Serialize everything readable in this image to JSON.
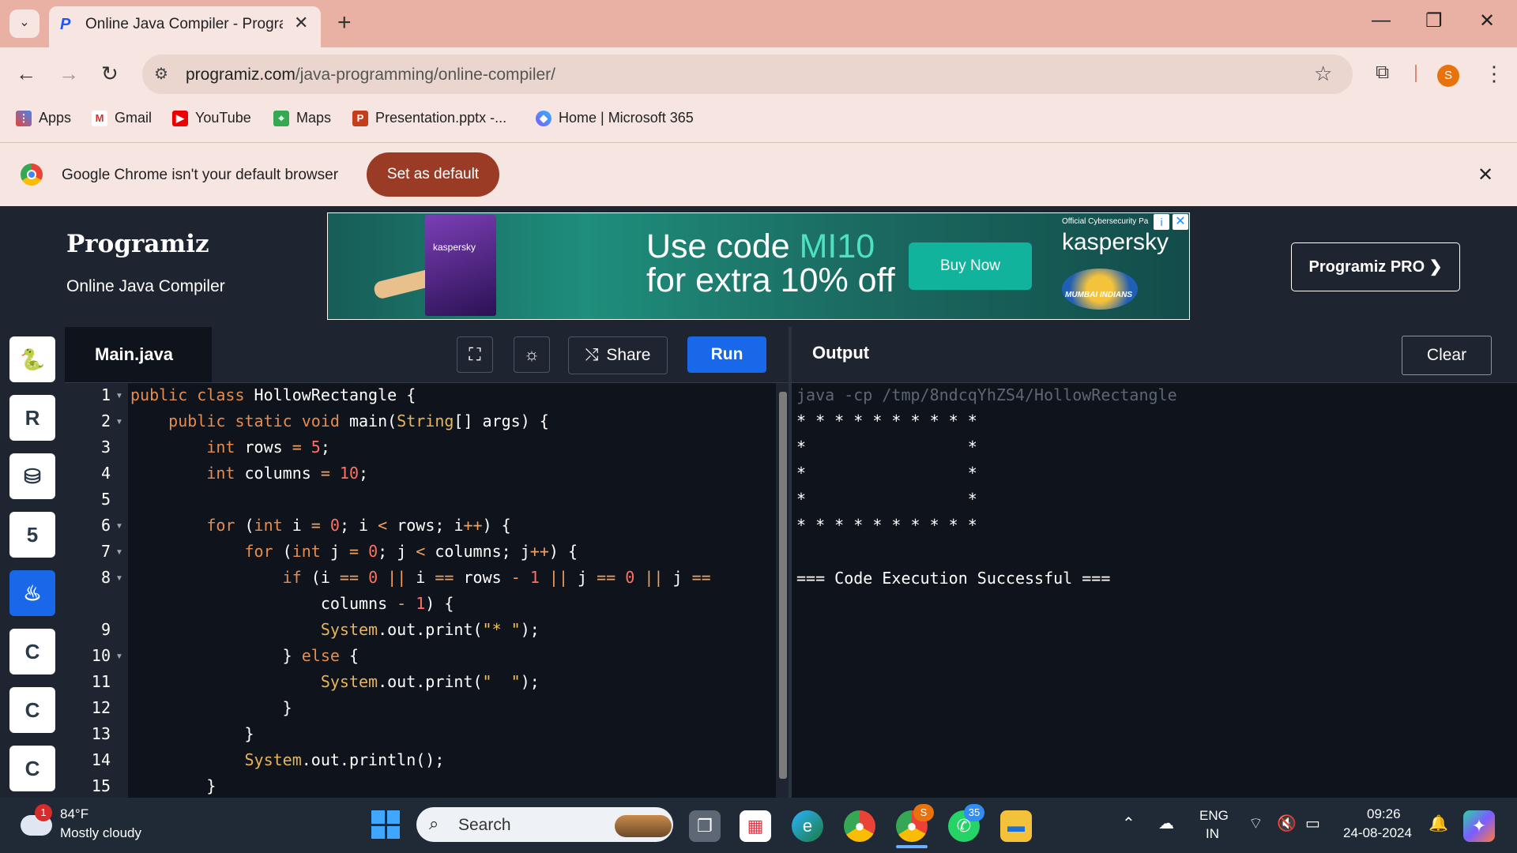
{
  "browser": {
    "tab_title": "Online Java Compiler - Program",
    "url_host": "programiz.com",
    "url_path": "/java-programming/online-compiler/",
    "avatar_letter": "S",
    "bookmarks": [
      "Apps",
      "Gmail",
      "YouTube",
      "Maps",
      "Presentation.pptx -...",
      "Home | Microsoft 365"
    ],
    "infobar": {
      "text": "Google Chrome isn't your default browser",
      "button": "Set as default"
    }
  },
  "header": {
    "logo": "Programiz",
    "subtitle": "Online Java Compiler",
    "pro_button": "Programiz PRO ❯"
  },
  "ad": {
    "line1_prefix": "Use code ",
    "line1_code": "MI10",
    "line2": "for extra 10% off",
    "buy": "Buy Now",
    "official": "Official Cybersecurity Pa",
    "brand": "kaspersky",
    "box_label": "kaspersky",
    "team": "MUMBAI INDIANS"
  },
  "editor": {
    "file_name": "Main.java",
    "share": "Share",
    "run": "Run",
    "line_numbers": [
      "1",
      "2",
      "3",
      "4",
      "5",
      "6",
      "7",
      "8",
      "",
      "9",
      "10",
      "11",
      "12",
      "13",
      "14",
      "15"
    ]
  },
  "output": {
    "title": "Output",
    "clear": "Clear",
    "lines": [
      "java -cp /tmp/8ndcqYhZS4/HollowRectangle",
      "* * * * * * * * * * ",
      "*                 * ",
      "*                 * ",
      "*                 * ",
      "* * * * * * * * * * ",
      "",
      "=== Code Execution Successful ==="
    ]
  },
  "taskbar": {
    "temp": "84°F",
    "weather": "Mostly cloudy",
    "weather_badge": "1",
    "search": "Search",
    "lang1": "ENG",
    "lang2": "IN",
    "time": "09:26",
    "date": "24-08-2024",
    "whatsapp_badge": "35",
    "chrome_badge": "S"
  }
}
